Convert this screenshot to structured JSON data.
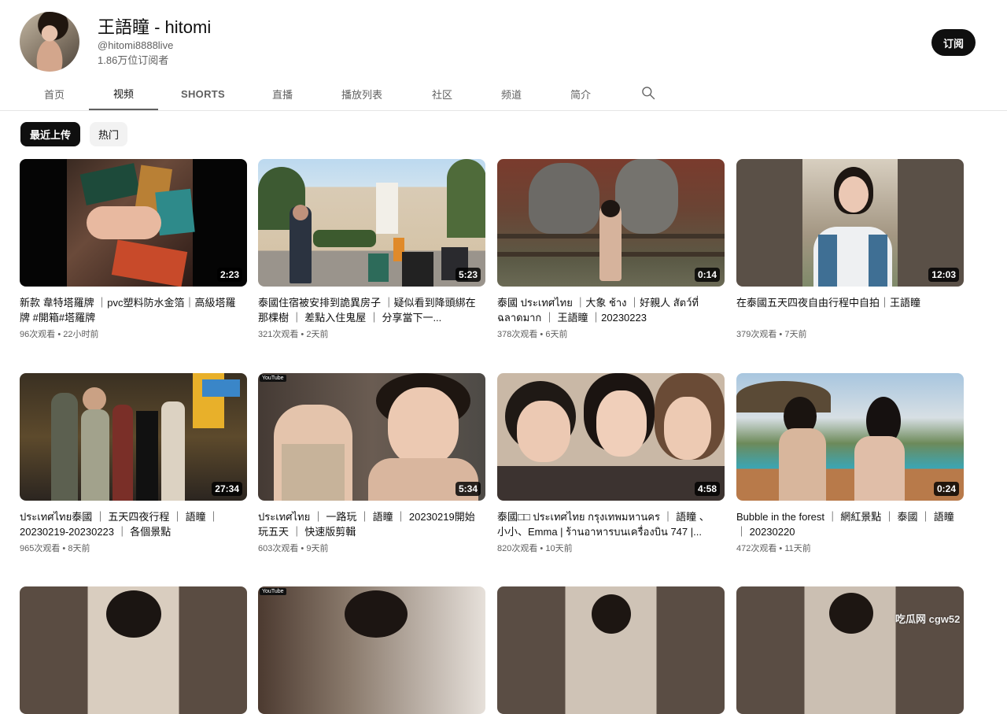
{
  "channel": {
    "name": "王語瞳 - hitomi",
    "handle": "@hitomi8888live",
    "subscribers": "1.86万位订阅者",
    "subscribe_label": "订阅"
  },
  "tabs": [
    {
      "label": "首页",
      "active": false
    },
    {
      "label": "视频",
      "active": true
    },
    {
      "label": "SHORTS",
      "active": false
    },
    {
      "label": "直播",
      "active": false
    },
    {
      "label": "播放列表",
      "active": false
    },
    {
      "label": "社区",
      "active": false
    },
    {
      "label": "频道",
      "active": false
    },
    {
      "label": "简介",
      "active": false
    }
  ],
  "search_icon": "search-icon",
  "chips": [
    {
      "label": "最近上传",
      "active": true
    },
    {
      "label": "热门",
      "active": false
    }
  ],
  "videos": [
    {
      "title": "新款 韋特塔羅牌 ｜pvc塑料防水金箔｜高級塔羅牌 #開箱#塔羅牌",
      "duration": "2:23",
      "views": "96次观看",
      "age": "22小时前"
    },
    {
      "title": "泰國住宿被安排到詭異房子 ｜疑似看到降頭綁在那棵樹 ｜ 差點入住鬼屋 ｜ 分享當下一...",
      "duration": "5:23",
      "views": "321次观看",
      "age": "2天前"
    },
    {
      "title": "泰國 ประเทศไทย ｜大象 ช้าง ｜好親人 สัตว์ที่ฉลาดมาก ｜ 王語瞳 ｜20230223",
      "duration": "0:14",
      "views": "378次观看",
      "age": "6天前"
    },
    {
      "title": "在泰國五天四夜自由行程中自拍｜王語瞳",
      "duration": "12:03",
      "views": "379次观看",
      "age": "7天前"
    },
    {
      "title": "ประเทศไทย泰國 ｜ 五天四夜行程 ｜ 語瞳 ｜ 20230219-20230223 ｜ 各個景點",
      "duration": "27:34",
      "views": "965次观看",
      "age": "8天前"
    },
    {
      "title": "ประเทศไทย ｜ 一路玩 ｜ 語瞳 ｜ 20230219開始玩五天 ｜ 快速版剪輯",
      "duration": "5:34",
      "views": "603次观看",
      "age": "9天前",
      "badge": "YouTube"
    },
    {
      "title": "泰國□□ ประเทศไทย กรุงเทพมหานคร ｜ 語瞳 、小小、Emma | ร้านอาหารบนเครื่องบิน 747 |...",
      "duration": "4:58",
      "views": "820次观看",
      "age": "10天前"
    },
    {
      "title": "Bubble in the forest ｜ 網紅景點 ｜ 泰國 ｜ 語瞳 ｜ 20230220",
      "duration": "0:24",
      "views": "472次观看",
      "age": "11天前"
    },
    {
      "title": "",
      "duration": "",
      "views": "",
      "age": ""
    },
    {
      "title": "",
      "duration": "",
      "views": "",
      "age": "",
      "badge": "YouTube"
    },
    {
      "title": "",
      "duration": "",
      "views": "",
      "age": ""
    },
    {
      "title": "",
      "duration": "",
      "views": "",
      "age": ""
    }
  ],
  "meta_separator": "•",
  "watermark": "吃瓜网 cgw52",
  "colors": {
    "primary": "#0f0f0f",
    "secondary": "#606060",
    "chip_bg": "#f2f2f2",
    "divider": "#e5e5e5"
  }
}
